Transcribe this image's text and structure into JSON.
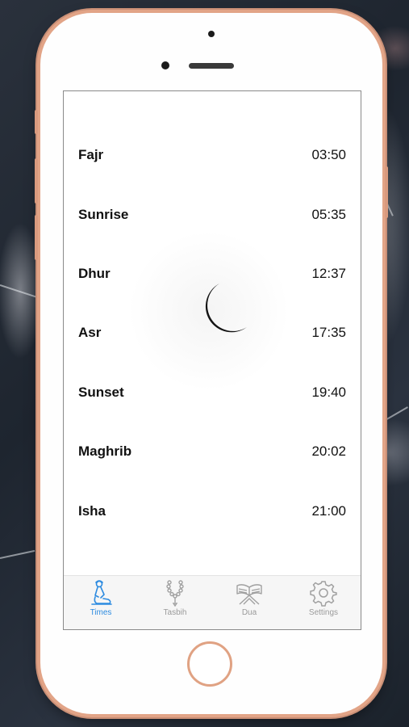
{
  "prayer_times": [
    {
      "name": "Fajr",
      "time": "03:50"
    },
    {
      "name": "Sunrise",
      "time": "05:35"
    },
    {
      "name": "Dhur",
      "time": "12:37"
    },
    {
      "name": "Asr",
      "time": "17:35"
    },
    {
      "name": "Sunset",
      "time": "19:40"
    },
    {
      "name": "Maghrib",
      "time": "20:02"
    },
    {
      "name": "Isha",
      "time": "21:00"
    }
  ],
  "tabs": [
    {
      "label": "Times",
      "icon": "prayer-person-icon",
      "active": true
    },
    {
      "label": "Tasbih",
      "icon": "prayer-beads-icon",
      "active": false
    },
    {
      "label": "Dua",
      "icon": "quran-stand-icon",
      "active": false
    },
    {
      "label": "Settings",
      "icon": "gear-icon",
      "active": false
    }
  ],
  "center_icon": "crescent-moon-icon",
  "colors": {
    "accent": "#2d8be0",
    "inactive_tab": "#9a9a9a",
    "phone_frame": "#e2a487",
    "text": "#111111"
  }
}
